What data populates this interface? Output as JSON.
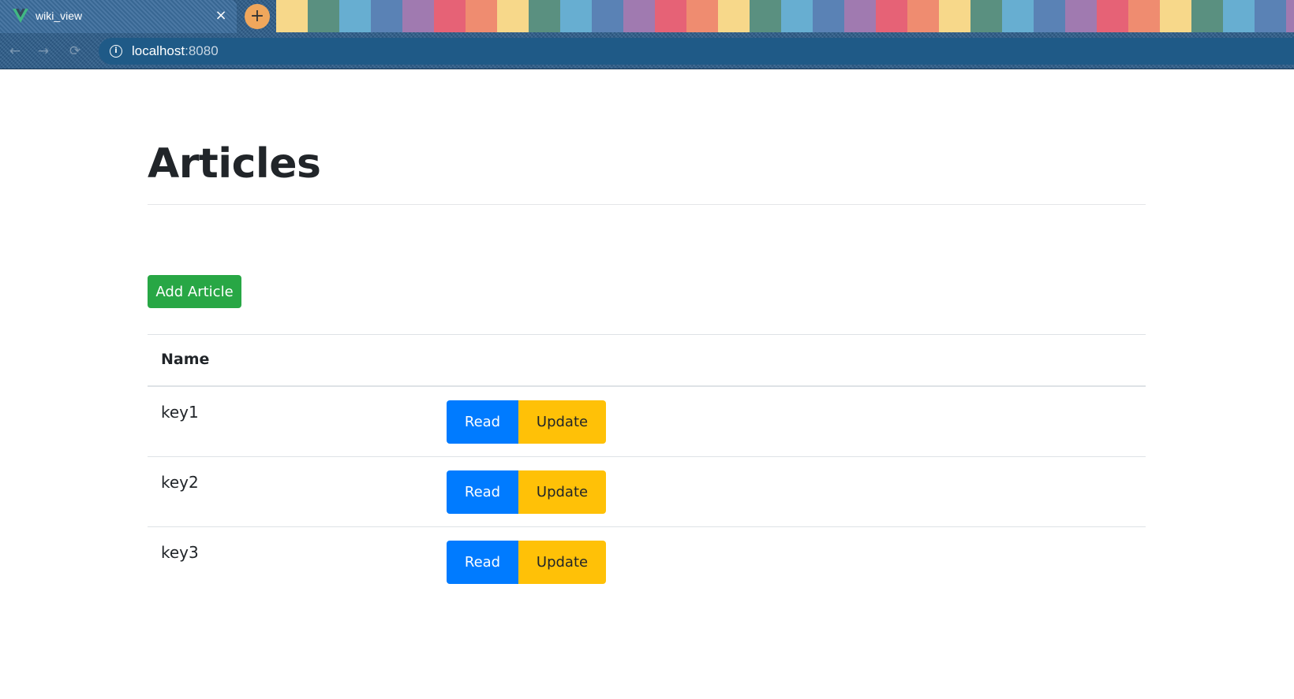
{
  "browser": {
    "tab": {
      "title": "wiki_view",
      "close_glyph": "×",
      "favicon": "vue-logo-icon"
    },
    "new_tab_glyph": "+",
    "nav": {
      "back_glyph": "←",
      "forward_glyph": "→",
      "reload_glyph": "⟳"
    },
    "address": {
      "info_glyph": "i",
      "host": "localhost",
      "port": ":8080"
    },
    "tab_strip_colors": [
      "#f7d88a",
      "#5a9080",
      "#67aed1",
      "#5a82b5",
      "#a07ab0",
      "#e66276",
      "#ef8c70"
    ]
  },
  "page": {
    "title": "Articles",
    "add_button": "Add Article",
    "table": {
      "headers": {
        "name": "Name"
      },
      "rows": [
        {
          "name": "key1",
          "read": "Read",
          "update": "Update"
        },
        {
          "name": "key2",
          "read": "Read",
          "update": "Update"
        },
        {
          "name": "key3",
          "read": "Read",
          "update": "Update"
        }
      ]
    }
  },
  "colors": {
    "success": "#28a745",
    "primary": "#007bff",
    "warning": "#ffc107",
    "text": "#212529",
    "border": "#dee2e6"
  }
}
